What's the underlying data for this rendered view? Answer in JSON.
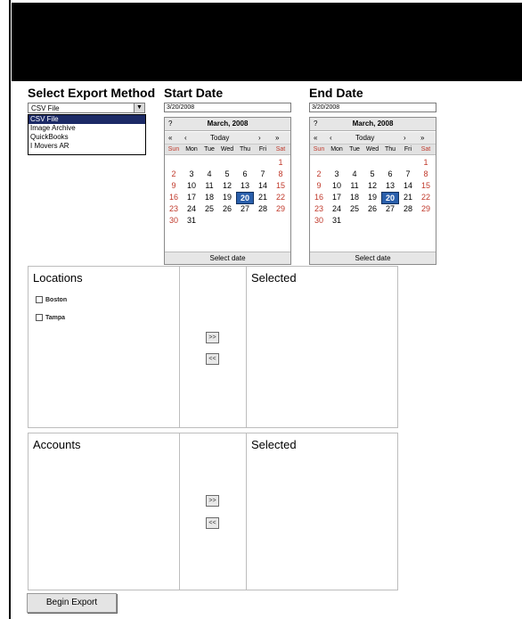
{
  "header": {},
  "export_method": {
    "label": "Select Export Method",
    "selected": "CSV File",
    "options": [
      "CSV File",
      "Image Archive",
      "QuickBooks",
      "I Movers AR"
    ]
  },
  "start_date": {
    "label": "Start Date",
    "value": "3/20/2008",
    "calendar": {
      "help": "?",
      "month": "March, 2008",
      "nav": [
        "«",
        "‹",
        "Today",
        "›",
        "»"
      ],
      "dows": [
        "Sun",
        "Mon",
        "Tue",
        "Wed",
        "Thu",
        "Fri",
        "Sat"
      ],
      "today": "20",
      "footer": "Select date"
    }
  },
  "end_date": {
    "label": "End Date",
    "value": "3/20/2008",
    "calendar": {
      "help": "?",
      "month": "March, 2008",
      "nav": [
        "«",
        "‹",
        "Today",
        "›",
        "»"
      ],
      "dows": [
        "Sun",
        "Mon",
        "Tue",
        "Wed",
        "Thu",
        "Fri",
        "Sat"
      ],
      "today": "20",
      "footer": "Select date"
    }
  },
  "locations": {
    "title": "Locations",
    "items": [
      "Boston",
      "Tampa"
    ],
    "selected_title": "Selected",
    "add": ">>",
    "remove": "<<"
  },
  "accounts": {
    "title": "Accounts",
    "selected_title": "Selected",
    "add": ">>",
    "remove": "<<"
  },
  "actions": {
    "begin_export": "Begin Export"
  },
  "colors": {
    "today": "#2a5fab",
    "weekend": "#c0392b",
    "dropdown_selected": "#1c2a66"
  }
}
